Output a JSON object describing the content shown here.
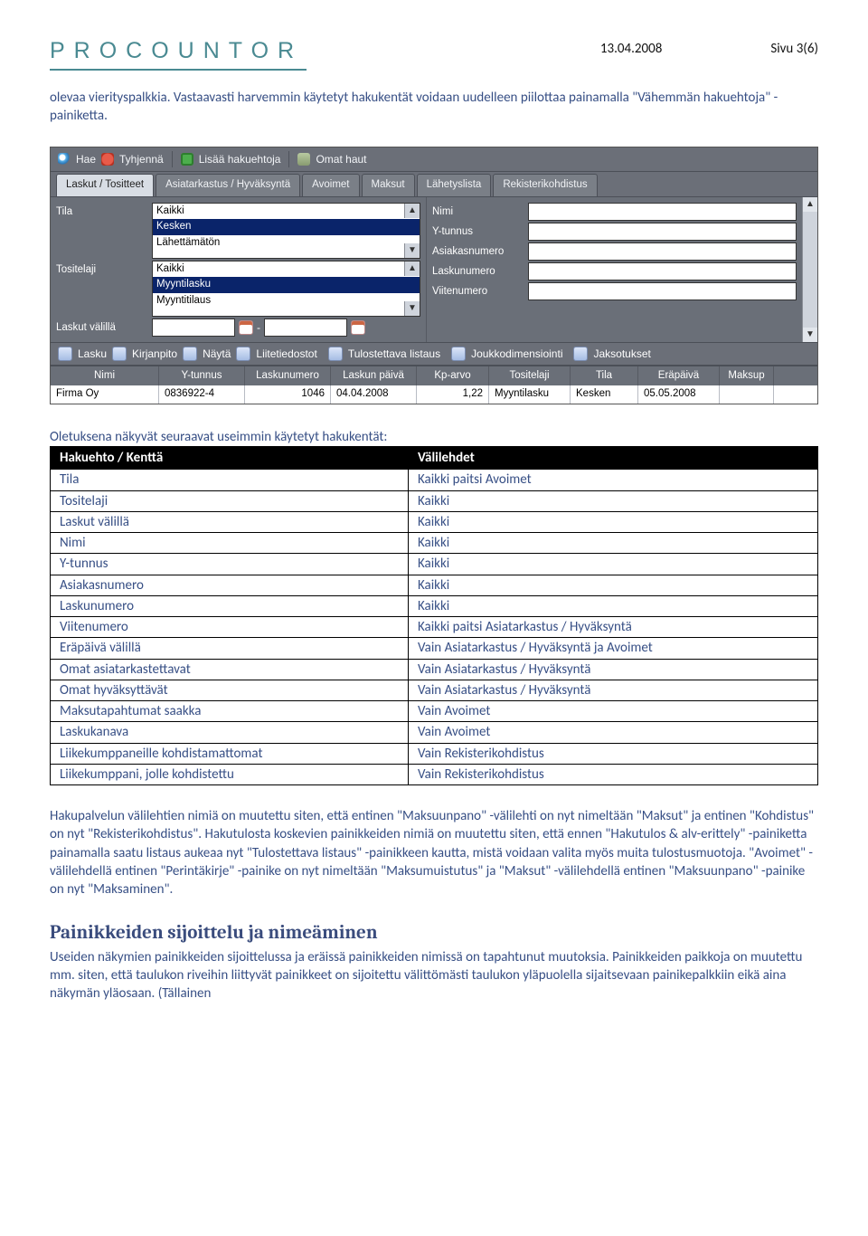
{
  "header": {
    "logo": "PROCOUNTOR",
    "date": "13.04.2008",
    "page": "Sivu 3(6)"
  },
  "intro": "olevaa vierityspalkkia. Vastaavasti harvemmin käytetyt hakukentät voidaan uudelleen piilottaa painamalla \"Vähemmän hakuehtoja\" -painiketta.",
  "app": {
    "toolbar1": {
      "search": "Hae",
      "clear": "Tyhjennä",
      "more": "Lisää hakuehtoja",
      "own": "Omat haut"
    },
    "tabs": [
      "Laskut / Tositteet",
      "Asiatarkastus / Hyväksyntä",
      "Avoimet",
      "Maksut",
      "Lähetyslista",
      "Rekisterikohdistus"
    ],
    "left_labels": {
      "tila": "Tila",
      "tositelaji": "Tositelaji",
      "valilla": "Laskut välillä"
    },
    "right_labels": {
      "nimi": "Nimi",
      "ytunnus": "Y-tunnus",
      "asiakasnumero": "Asiakasnumero",
      "laskunumero": "Laskunumero",
      "viitenumero": "Viitenumero"
    },
    "tila_opts": [
      "Kaikki",
      "Kesken",
      "Lähettämätön"
    ],
    "tositelaji_opts": [
      "Kaikki",
      "Myyntilasku",
      "Myyntitilaus"
    ],
    "toolbar2": [
      "Lasku",
      "Kirjanpito",
      "Näytä",
      "Liitetiedostot",
      "Tulostettava listaus",
      "Joukkodimensiointi",
      "Jaksotukset"
    ],
    "grid_headers": [
      "Nimi",
      "Y-tunnus",
      "Laskunumero",
      "Laskun päivä",
      "Kp-arvo",
      "Tositelaji",
      "Tila",
      "Eräpäivä",
      "Maksup"
    ],
    "grid_row": [
      "Firma Oy",
      "0836922-4",
      "1046",
      "04.04.2008",
      "1,22",
      "Myyntilasku",
      "Kesken",
      "05.05.2008",
      ""
    ]
  },
  "defaults_intro": "Oletuksena näkyvät seuraavat useimmin käytetyt hakukentät:",
  "def_header": {
    "a": "Hakuehto / Kenttä",
    "b": "Välilehdet"
  },
  "defs": [
    {
      "a": "Tila",
      "b": "Kaikki paitsi Avoimet"
    },
    {
      "a": "Tositelaji",
      "b": "Kaikki"
    },
    {
      "a": "Laskut välillä",
      "b": "Kaikki"
    },
    {
      "a": "Nimi",
      "b": "Kaikki"
    },
    {
      "a": "Y-tunnus",
      "b": "Kaikki"
    },
    {
      "a": "Asiakasnumero",
      "b": "Kaikki"
    },
    {
      "a": "Laskunumero",
      "b": "Kaikki"
    },
    {
      "a": "Viitenumero",
      "b": "Kaikki paitsi Asiatarkastus / Hyväksyntä"
    },
    {
      "a": "Eräpäivä välillä",
      "b": "Vain Asiatarkastus / Hyväksyntä ja Avoimet"
    },
    {
      "a": "Omat asiatarkastettavat",
      "b": "Vain Asiatarkastus / Hyväksyntä"
    },
    {
      "a": "Omat hyväksyttävät",
      "b": "Vain Asiatarkastus / Hyväksyntä"
    },
    {
      "a": "Maksutapahtumat saakka",
      "b": "Vain Avoimet"
    },
    {
      "a": "Laskukanava",
      "b": "Vain Avoimet"
    },
    {
      "a": "Liikekumppaneille kohdistamattomat",
      "b": "Vain Rekisterikohdistus"
    },
    {
      "a": "Liikekumppani, jolle kohdistettu",
      "b": "Vain Rekisterikohdistus"
    }
  ],
  "para2": "Hakupalvelun välilehtien nimiä on muutettu siten, että entinen \"Maksuunpano\" -välilehti on nyt nimeltään \"Maksut\" ja entinen \"Kohdistus\" on nyt \"Rekisterikohdistus\". Hakutulosta koskevien painikkeiden nimiä on muutettu siten, että ennen \"Hakutulos & alv-erittely\" -painiketta painamalla saatu listaus aukeaa nyt \"Tulostettava listaus\" -painikkeen kautta, mistä voidaan valita myös muita tulostusmuotoja.  \"Avoimet\" -välilehdellä entinen \"Perintäkirje\" -painike on nyt nimeltään \"Maksumuistutus\" ja \"Maksut\" -välilehdellä entinen \"Maksuunpano\" -painike on nyt \"Maksaminen\".",
  "h2": "Painikkeiden sijoittelu ja nimeäminen",
  "para3": "Useiden näkymien painikkeiden sijoittelussa ja eräissä painikkeiden nimissä on tapahtunut muutoksia. Painikkeiden paikkoja on muutettu mm. siten, että taulukon riveihin liittyvät painikkeet on sijoitettu välittömästi taulukon yläpuolella sijaitsevaan painikepalkkiin eikä aina näkymän yläosaan. (Tällainen"
}
